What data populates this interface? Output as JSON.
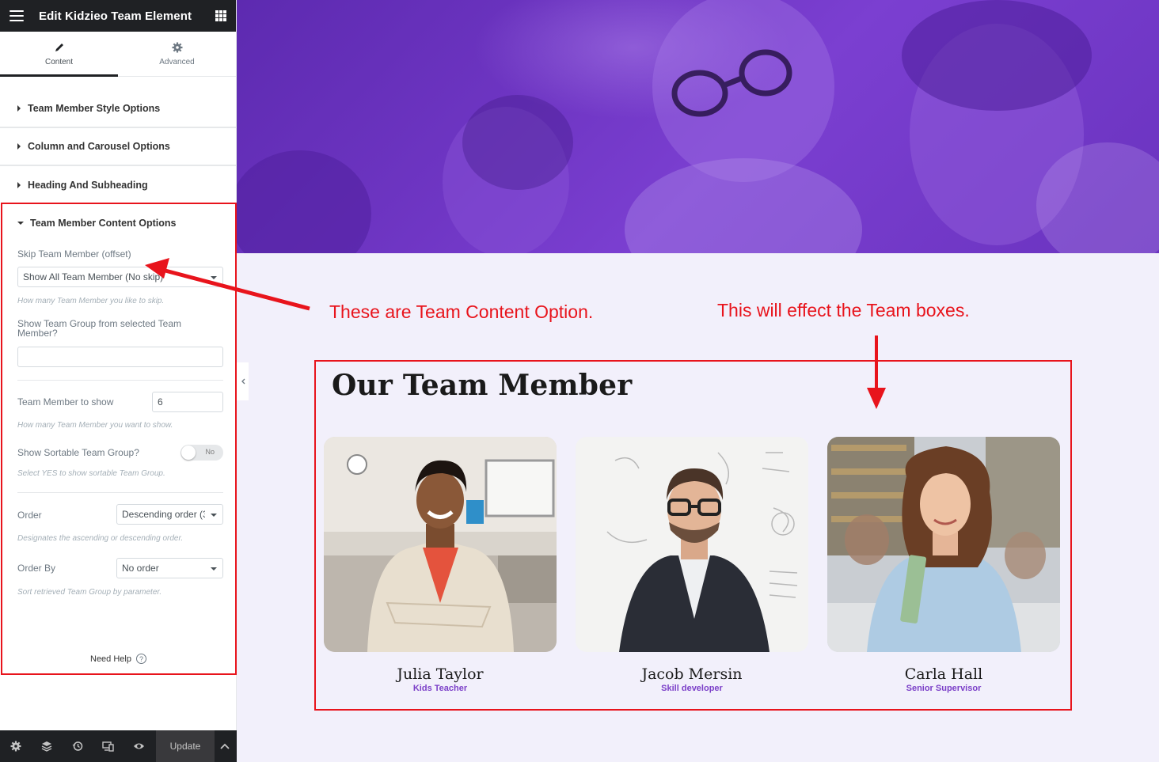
{
  "sidebar": {
    "title": "Edit Kidzieo Team Element",
    "tabs": [
      {
        "label": "Content",
        "icon": "pencil-icon",
        "active": true
      },
      {
        "label": "Advanced",
        "icon": "gear-icon",
        "active": false
      }
    ],
    "sections": [
      {
        "label": "Team Member Style Options"
      },
      {
        "label": "Column and Carousel Options"
      },
      {
        "label": "Heading And Subheading"
      }
    ],
    "content_options": {
      "title": "Team Member Content Options",
      "skip_label": "Skip Team Member (offset)",
      "skip_value": "Show All Team Member (No skip)",
      "skip_desc": "How many Team Member you like to skip.",
      "group_label": "Show Team Group from selected Team Member?",
      "group_value": "",
      "show_label": "Team Member to show",
      "show_value": "6",
      "show_desc": "How many Team Member you want to show.",
      "sortable_label": "Show Sortable Team Group?",
      "sortable_value": "No",
      "sortable_desc": "Select YES to show sortable Team Group.",
      "order_label": "Order",
      "order_value": "Descending order (3",
      "order_desc": "Designates the ascending or descending order.",
      "orderby_label": "Order By",
      "orderby_value": "No order",
      "orderby_desc": "Sort retrieved Team Group by parameter."
    },
    "need_help": "Need Help",
    "bottom": {
      "update_label": "Update",
      "icons": [
        "settings-icon",
        "layers-icon",
        "history-icon",
        "responsive-icon",
        "eye-icon",
        "chevron-up-icon"
      ]
    }
  },
  "annotations": {
    "left": "These are Team Content Option.",
    "right": "This will effect the Team boxes.",
    "color": "#e8141c"
  },
  "team": {
    "title": "Our Team Member",
    "members": [
      {
        "name": "Julia Taylor",
        "role": "Kids Teacher"
      },
      {
        "name": "Jacob Mersin",
        "role": "Skill developer"
      },
      {
        "name": "Carla Hall",
        "role": "Senior Supervisor"
      }
    ]
  },
  "colors": {
    "hero_purple": "#6f36c4",
    "role_purple": "#7b3fc8",
    "page_bg": "#f2f0fb",
    "editor_dark": "#1f2124"
  }
}
